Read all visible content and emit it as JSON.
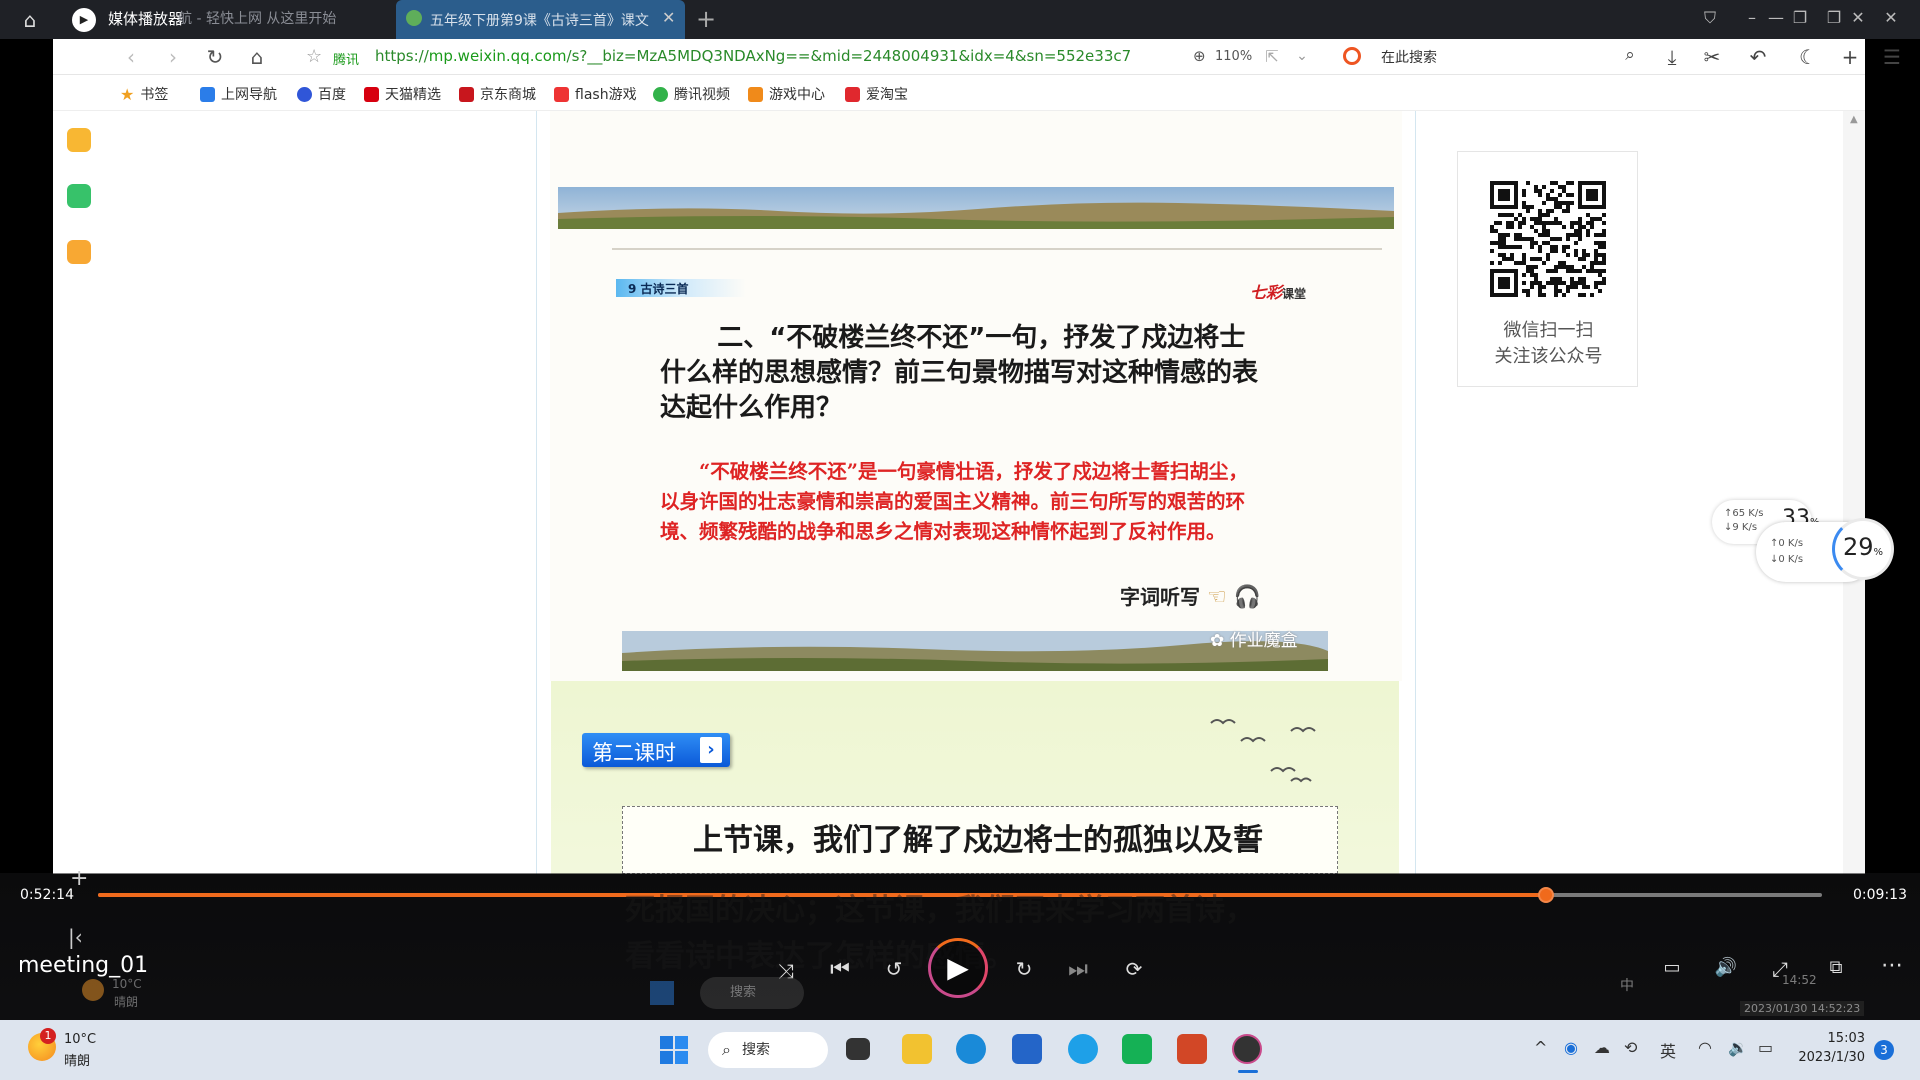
{
  "player": {
    "app_title": "媒体播放器",
    "file_name": "meeting_01",
    "time_elapsed": "0:52:14",
    "time_remaining": "0:09:13",
    "progress": 0.84,
    "accent": "#f06a1c"
  },
  "browser": {
    "background_tab": "航 - 轻快上网 从这里开始",
    "active_tab": "五年级下册第9课《古诗三首》课文",
    "url_prefix": "https://",
    "url_domain": "mp.weixin.qq.com",
    "url_rest": "/s?__biz=MzA5MDQ3NDAxNg==&mid=2448004931&idx=4&sn=552e33c7",
    "security_label": "腾讯",
    "zoom": "110%",
    "search_placeholder": "在此搜索",
    "bookmarks": [
      "书签",
      "上网导航",
      "百度",
      "天猫精选",
      "京东商城",
      "flash游戏",
      "腾讯视频",
      "游戏中心",
      "爱淘宝"
    ]
  },
  "article": {
    "lesson_tag": "9  古诗三首",
    "brand": "七彩",
    "brand_sub": "课堂",
    "question": "二、“不破楼兰终不还”一句，抒发了戍边将士什么样的思想感情？前三句景物描写对这种情感的表达起什么作用？",
    "answer": "“不破楼兰终不还”是一句豪情壮语，抒发了戍边将士誓扫胡尘，以身许国的壮志豪情和崇高的爱国主义精神。前三句所写的艰苦的环境、频繁残酷的战争和思乡之情对表现这种情怀起到了反衬作用。",
    "listen_label": "字词听写",
    "watermark": "作业魔盒",
    "session_badge": "第二课时",
    "body_line1": "上节课，我们了解了戍边将士的孤独以及誓",
    "body_line2": "死报国的决心；这节课，我们再来学习两首诗，",
    "body_line3": "看看诗中表达了怎样的感情。"
  },
  "qr": {
    "line1": "微信扫一扫",
    "line2": "关注该公众号"
  },
  "speed_widget": {
    "back_pct": "33",
    "back_up": "65 K/s",
    "back_down": "9 K/s",
    "front_pct": "29",
    "front_up": "0 K/s",
    "front_down": "0 K/s",
    "pct_unit": "%"
  },
  "taskbar": {
    "weather_badge": "1",
    "temperature": "10°C",
    "weather": "晴朗",
    "search_label": "搜索",
    "ime_label": "英",
    "time": "15:03",
    "date": "2023/1/30",
    "notification_count": "3"
  },
  "inner_taskbar": {
    "search_label": "搜索",
    "ime_label": "中",
    "time": "14:52",
    "timestamp": "2023/01/30 14:52:23"
  }
}
